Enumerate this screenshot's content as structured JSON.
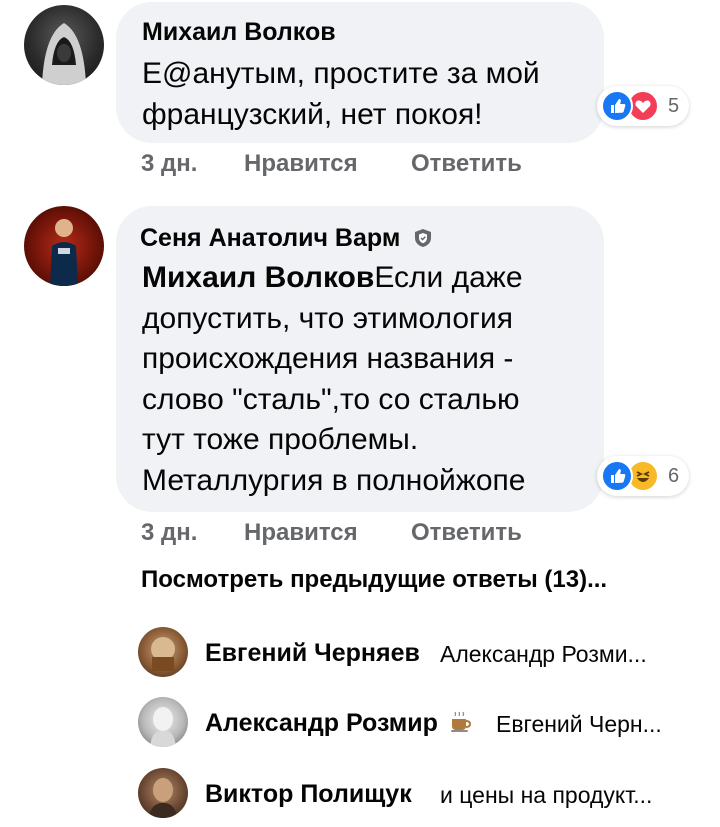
{
  "comments": [
    {
      "author": "Михаил Волков",
      "text_lines": [
        "E@анутым, простите за мой",
        "французский, нет покоя!"
      ],
      "reactions": {
        "icons": [
          "like-icon",
          "love-icon"
        ],
        "count": "5"
      },
      "time": "3 дн.",
      "like_label": "Нравится",
      "reply_label": "Ответить"
    },
    {
      "author": "Сеня Анатолич Варм",
      "mention": "Михаил Волков",
      "text_first": "Если даже",
      "text_lines": [
        "допустить, что этимология",
        "происхождения названия -",
        "слово \"сталь\",то со сталью",
        "тут тоже проблемы.",
        "Металлургия в полнойжопе"
      ],
      "reactions": {
        "icons": [
          "like-icon",
          "haha-icon"
        ],
        "count": "6"
      },
      "time": "3 дн.",
      "like_label": "Нравится",
      "reply_label": "Ответить"
    }
  ],
  "view_previous": "Посмотреть предыдущие ответы (13)...",
  "replies": [
    {
      "author": "Евгений Черняев",
      "preview": "Александр Розми..."
    },
    {
      "author": "Александр Розмир",
      "preview": "Евгений Черн...",
      "emoji_icon": "coffee-icon"
    },
    {
      "author": "Виктор Полищук",
      "preview": "и цены на продукт..."
    }
  ],
  "colors": {
    "bubble": "#f0f2f5",
    "like_blue": "#1877f2",
    "love_red": "#f33e58",
    "haha_yellow": "#f7b928",
    "meta_gray": "#65676b"
  }
}
